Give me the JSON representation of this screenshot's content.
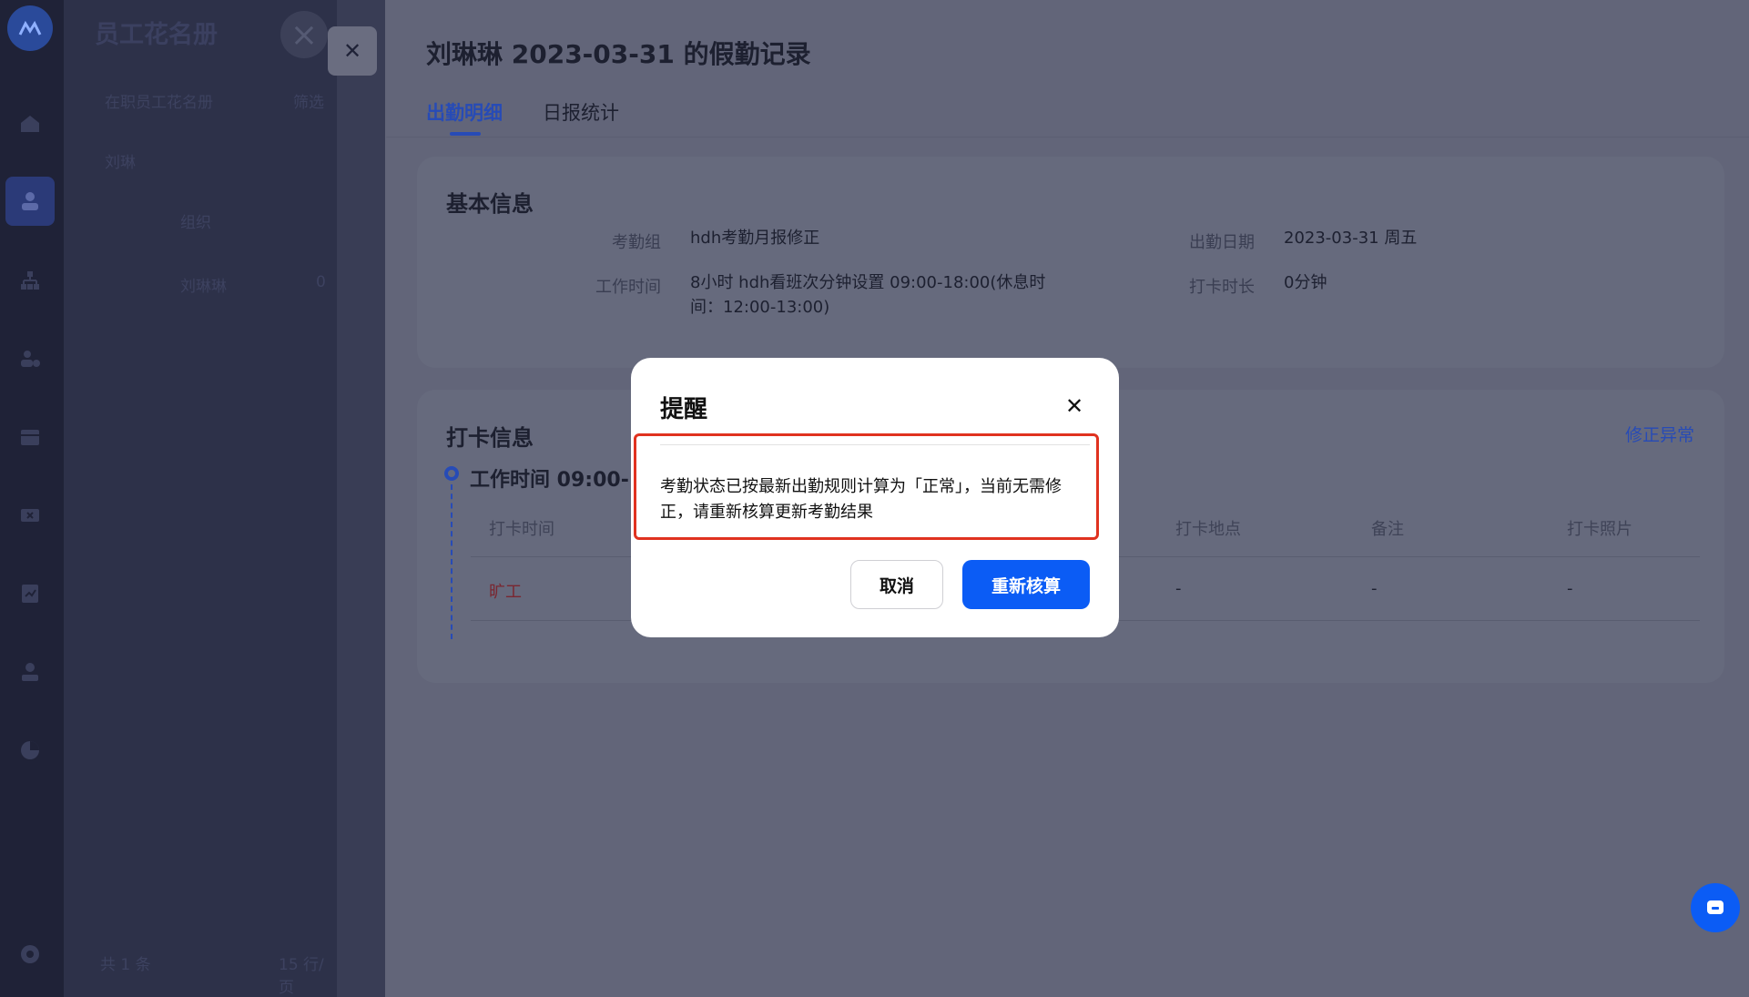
{
  "roster": {
    "title": "员工花名册",
    "filter": "在职员工花名册",
    "filter2": "筛选",
    "search": "刘琳",
    "group": "组织",
    "row_name": "刘琳琳",
    "row_extra": "0",
    "footer": "共 1 条",
    "footer_page": "15 行/页"
  },
  "detail": {
    "page_title": "刘琳琳 2023-03-31 的假勤记录",
    "tabs": [
      {
        "label": "出勤明细"
      },
      {
        "label": "日报统计"
      }
    ],
    "basic": {
      "title": "基本信息",
      "group_label": "考勤组",
      "group_value": "hdh考勤月报修正",
      "date_label": "出勤日期",
      "date_value": "2023-03-31 周五",
      "worktime_label": "工作时间",
      "worktime_value_line1": "8小时 hdh看班次分钟设置 09:00-18:00(休息时",
      "worktime_value_line2": "间：12:00-13:00)",
      "duration_label": "打卡时长",
      "duration_value": "0分钟"
    },
    "punch": {
      "title": "打卡信息",
      "fix_link": "修正异常",
      "worktime": "工作时间  09:00-1",
      "columns": [
        "打卡时间",
        "打卡地点",
        "备注",
        "打卡照片"
      ],
      "row": [
        "旷工",
        "-",
        "-",
        "-"
      ]
    }
  },
  "modal": {
    "title": "提醒",
    "message": "考勤状态已按最新出勤规则计算为「正常」，当前无需修正，请重新核算更新考勤结果",
    "cancel_label": "取消",
    "ok_label": "重新核算"
  },
  "colors": {
    "primary": "#0b5cf5",
    "highlight": "#e0321f",
    "sidebar": "#1f2237"
  }
}
